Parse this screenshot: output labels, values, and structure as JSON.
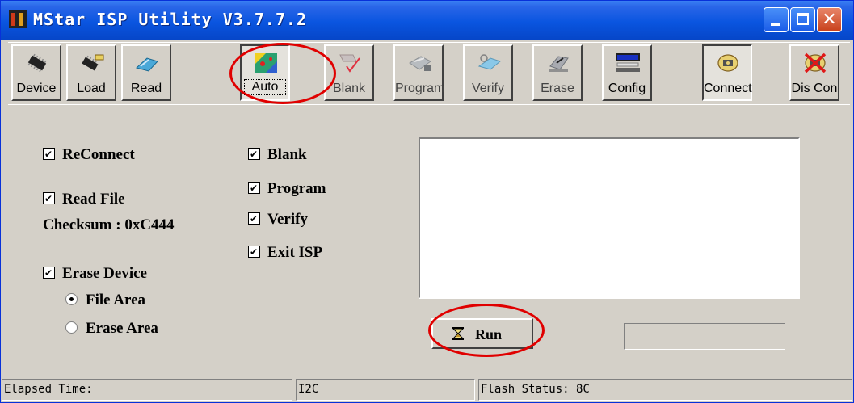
{
  "window": {
    "title": "MStar ISP Utility V3.7.7.2",
    "colors": {
      "titlebar": "#0a55e0",
      "face": "#d4d0c8",
      "annotation": "#e00000"
    }
  },
  "toolbar": {
    "buttons": [
      {
        "label": "Device",
        "icon": "chip-icon"
      },
      {
        "label": "Load",
        "icon": "load-chip-icon"
      },
      {
        "label": "Read",
        "icon": "read-icon"
      },
      {
        "label": "Auto",
        "icon": "auto-icon"
      },
      {
        "label": "Blank",
        "icon": "blank-icon"
      },
      {
        "label": "Program",
        "icon": "program-icon"
      },
      {
        "label": "Verify",
        "icon": "verify-icon"
      },
      {
        "label": "Erase",
        "icon": "erase-icon"
      },
      {
        "label": "Config",
        "icon": "config-icon"
      },
      {
        "label": "Connect",
        "icon": "connect-icon"
      },
      {
        "label": "Dis Con",
        "icon": "disconnect-icon"
      }
    ]
  },
  "options": {
    "reconnect": "ReConnect",
    "read_file": "Read File",
    "checksum": "Checksum : 0xC444",
    "erase_device": "Erase Device",
    "file_area": "File Area",
    "erase_area": "Erase Area",
    "blank": "Blank",
    "program": "Program",
    "verify": "Verify",
    "exit_isp": "Exit ISP"
  },
  "run_button": {
    "label": "Run"
  },
  "status": {
    "elapsed": "Elapsed Time:",
    "interface": "I2C",
    "flash": "Flash Status: 8C"
  }
}
